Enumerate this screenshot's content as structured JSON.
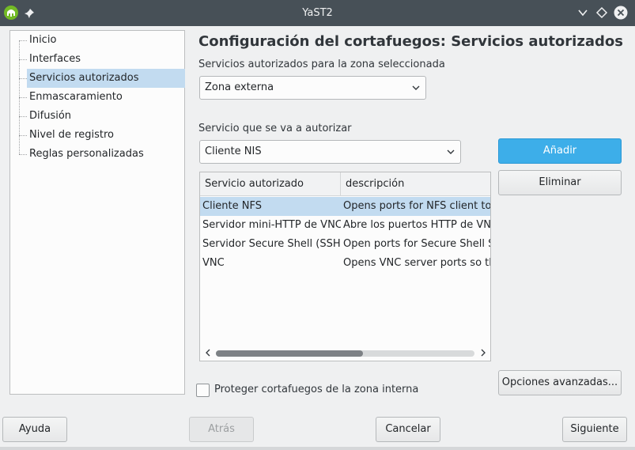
{
  "window": {
    "title": "YaST2"
  },
  "sidebar": {
    "items": [
      {
        "label": "Inicio"
      },
      {
        "label": "Interfaces"
      },
      {
        "label": "Servicios autorizados",
        "selected": true
      },
      {
        "label": "Enmascaramiento"
      },
      {
        "label": "Difusión"
      },
      {
        "label": "Nivel de registro"
      },
      {
        "label": "Reglas personalizadas"
      }
    ]
  },
  "main": {
    "title": "Configuración del cortafuegos: Servicios autorizados",
    "zone_label": "Servicios autorizados para la zona seleccionada",
    "zone_value": "Zona externa",
    "service_label": "Servicio que se va a autorizar",
    "service_value": "Cliente NIS",
    "add_label": "Añadir",
    "remove_label": "Eliminar",
    "advanced_label": "Opciones avanzadas...",
    "protect_label": "Proteger cortafuegos de la zona interna",
    "protect_checked": false,
    "table": {
      "columns": [
        "Servicio autorizado",
        "descripción"
      ],
      "rows": [
        {
          "service": "Cliente NFS",
          "description": "Opens ports for NFS client to a",
          "selected": true
        },
        {
          "service": "Servidor mini-HTTP de VNC",
          "description": "Abre los puertos HTTP de VNC"
        },
        {
          "service": "Servidor Secure Shell (SSH)",
          "description": "Open ports for Secure Shell Se"
        },
        {
          "service": "VNC",
          "description": "Opens VNC server ports so tha"
        }
      ]
    }
  },
  "footer": {
    "help_label": "Ayuda",
    "back_label": "Atrás",
    "cancel_label": "Cancelar",
    "next_label": "Siguiente"
  },
  "colors": {
    "titlebar": "#475057",
    "accent": "#3daee9",
    "selection": "#c2dbf0",
    "window_bg": "#eff0f1"
  },
  "icons": {
    "app": "yast-chameleon-icon",
    "pin": "pin-icon",
    "minimize": "chevron-down-icon",
    "maximize": "diamond-icon",
    "close": "close-icon"
  }
}
